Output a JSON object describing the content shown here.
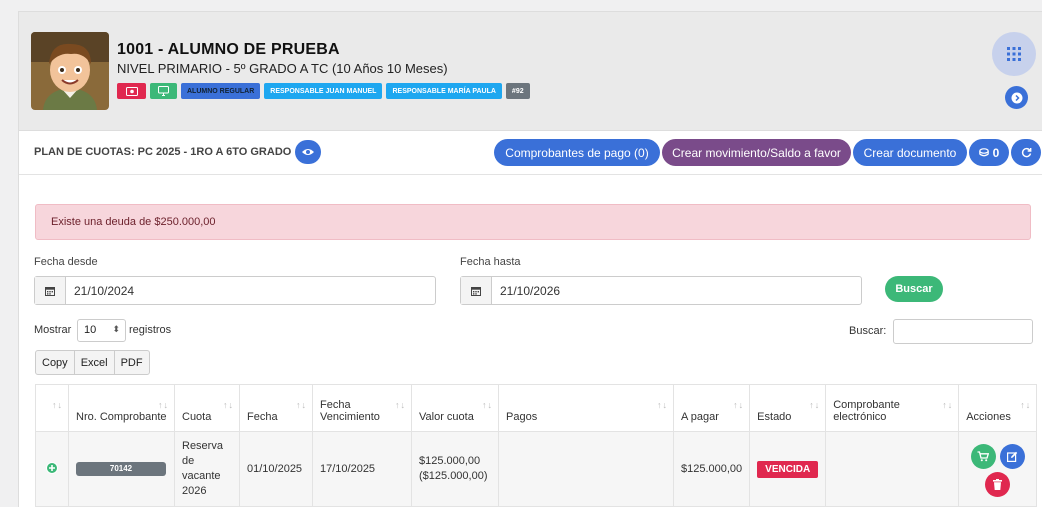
{
  "student": {
    "title": "1001 - ALUMNO DE PRUEBA",
    "level": "NIVEL PRIMARIO - 5º GRADO A TC (10 Años 10 Meses)",
    "badges": [
      {
        "label": "",
        "icon": "money-icon",
        "color": "#e0284f"
      },
      {
        "label": "",
        "icon": "monitor-icon",
        "color": "#3cb878"
      },
      {
        "label": "ALUMNO REGULAR",
        "color": "#3a70d8"
      },
      {
        "label": "RESPONSABLE JUAN MANUEL",
        "color": "#1ea7f0"
      },
      {
        "label": "RESPONSABLE MARÍA PAULA",
        "color": "#1ea7f0"
      },
      {
        "label": "#92",
        "color": "#6c757d"
      }
    ]
  },
  "plan": {
    "title": "PLAN DE CUOTAS: PC 2025 - 1RO A 6TO GRADO",
    "buttons": {
      "comprobantes": "Comprobantes de pago (0)",
      "crear_movimiento": "Crear movimiento/Saldo a favor",
      "crear_documento": "Crear documento",
      "counter": "0"
    }
  },
  "alert": {
    "text": "Existe una deuda de $250.000,00"
  },
  "filters": {
    "fecha_desde_label": "Fecha desde",
    "fecha_desde_value": "21/10/2024",
    "fecha_hasta_label": "Fecha hasta",
    "fecha_hasta_value": "21/10/2026",
    "buscar_button": "Buscar"
  },
  "table_controls": {
    "mostrar_label": "Mostrar",
    "page_size": "10",
    "registros_label": "registros",
    "search_label": "Buscar:",
    "export_buttons": [
      "Copy",
      "Excel",
      "PDF"
    ]
  },
  "table": {
    "headers": [
      "",
      "Nro. Comprobante",
      "Cuota",
      "Fecha",
      "Fecha Vencimiento",
      "Valor cuota",
      "Pagos",
      "A pagar",
      "Estado",
      "Comprobante electrónico",
      "Acciones"
    ],
    "rows": [
      {
        "nro": "70142",
        "cuota": "Reserva de vacante 2026",
        "fecha": "01/10/2025",
        "vencimiento": "17/10/2025",
        "valor": "$125.000,00",
        "valor_sub": "($125.000,00)",
        "pagos": "",
        "a_pagar": "$125.000,00",
        "estado": "VENCIDA",
        "comprobante": ""
      }
    ]
  },
  "colors": {
    "primary": "#3a70d8",
    "purple": "#7a4b8a",
    "success": "#3cb878",
    "danger": "#e0284f"
  }
}
